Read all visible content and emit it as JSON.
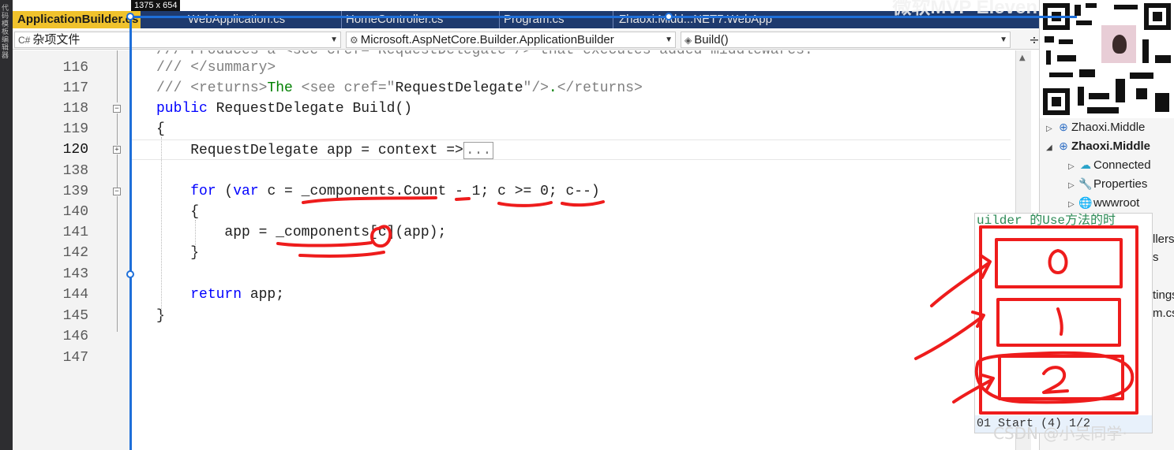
{
  "left_strip_text": "代码模板编辑器",
  "size_indicator": "1375 x 654",
  "tabs": [
    {
      "label": "ApplicationBuilder.cs",
      "active": true
    },
    {
      "label": "WebApplication.cs",
      "active": false
    },
    {
      "label": "HomeController.cs",
      "active": false
    },
    {
      "label": "Program.cs",
      "active": false
    },
    {
      "label": "Zhaoxi.Midd...NET7.WebApp",
      "active": false
    }
  ],
  "overlay_top_text": "微软MVP Eleven",
  "navbar": {
    "project": "杂项文件",
    "class": "Microsoft.AspNetCore.Builder.ApplicationBuilder",
    "member": "Build()"
  },
  "editor": {
    "line_numbers": [
      "116",
      "117",
      "118",
      "119",
      "120",
      "138",
      "139",
      "140",
      "141",
      "142",
      "143",
      "144",
      "145",
      "146",
      "147"
    ],
    "current_line": "120",
    "partial_top_line": "/// Produces a <see cref=\"RequestDelegate\"/> that executes added middlewares.",
    "lines": {
      "l116": "/// </summary>",
      "l117_a": "/// <returns>",
      "l117_b": "The ",
      "l117_c": "<see cref=\"",
      "l117_d": "RequestDelegate",
      "l117_e": "\"/>",
      "l117_f": ".",
      "l117_g": "</returns>",
      "l118_kw": "public",
      "l118_rest": " RequestDelegate Build()",
      "l119": "{",
      "l120_a": "    RequestDelegate app = context =>",
      "l120_collapsed": "...",
      "l139_kw1": "for",
      "l139_b": " (",
      "l139_kw2": "var",
      "l139_c": " c = _components.Count - 1; c >= 0; c--)",
      "l140": "    {",
      "l141": "        app = _components[c](app);",
      "l142": "    }",
      "l144_kw": "return",
      "l144_rest": " app;",
      "l145": "}",
      "l146": "}"
    }
  },
  "solution_explorer": {
    "items": [
      {
        "label": "Zhaoxi.Middle",
        "bold": false,
        "expanded": false,
        "icon": "web-project-icon"
      },
      {
        "label": "Zhaoxi.Middle",
        "bold": true,
        "expanded": true,
        "icon": "web-project-icon"
      },
      {
        "label": "Connected",
        "bold": false,
        "expanded": false,
        "icon": "connected-services-icon"
      },
      {
        "label": "Properties",
        "bold": false,
        "expanded": false,
        "icon": "properties-icon"
      },
      {
        "label": "wwwroot",
        "bold": false,
        "expanded": false,
        "icon": "globe-icon"
      }
    ],
    "partial_labels": [
      "llers",
      "s",
      "tings",
      "m.cs"
    ]
  },
  "popup": {
    "header": "uilder 的Use方法的时",
    "footer": "01 Start (4) 1/2",
    "boxes": [
      "0",
      "1",
      "2"
    ]
  },
  "watermark": "CSDN @小吴同学·",
  "colors": {
    "tab_active": "#f0c22c",
    "tab_bar": "#1e3a6e",
    "selection_frame": "#1e6fd9",
    "keyword": "#0000ff",
    "comment": "#008000",
    "annotation_ink": "#ee1c1c"
  }
}
